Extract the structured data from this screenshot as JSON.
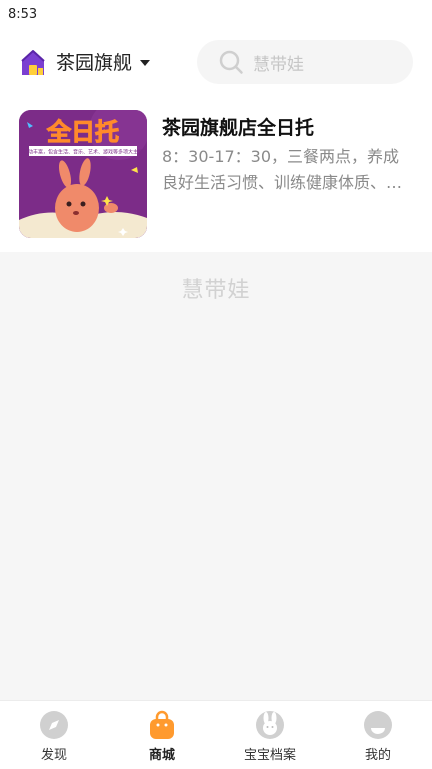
{
  "status_bar": {
    "time": "8:53"
  },
  "header": {
    "store_name": "茶园旗舰",
    "store_icon": "house-icon",
    "search": {
      "placeholder": "慧带娃",
      "icon": "search-icon"
    }
  },
  "products": [
    {
      "title": "茶园旗舰店全日托",
      "description": "8：30-17：30，三餐两点，养成良好生活习惯、训练健康体质、…",
      "thumbnail": {
        "headline": "全日托",
        "banner_text": "活动丰富，包含生活、音乐、艺术、游戏等多项大主题",
        "colors": {
          "background": "#7c2c88",
          "headline": "#ffe24a"
        }
      }
    }
  ],
  "watermark": "慧带娃",
  "tabs": [
    {
      "label": "发现",
      "icon": "compass-icon",
      "active": false
    },
    {
      "label": "商城",
      "icon": "shopping-bag-icon",
      "active": true
    },
    {
      "label": "宝宝档案",
      "icon": "rabbit-icon",
      "active": false
    },
    {
      "label": "我的",
      "icon": "profile-icon",
      "active": false
    }
  ],
  "colors": {
    "accent": "#ff9a2e",
    "inactive_icon": "#d0d0d0",
    "store_icon": "#7b3fd1",
    "page_background": "#f6f6f6"
  }
}
